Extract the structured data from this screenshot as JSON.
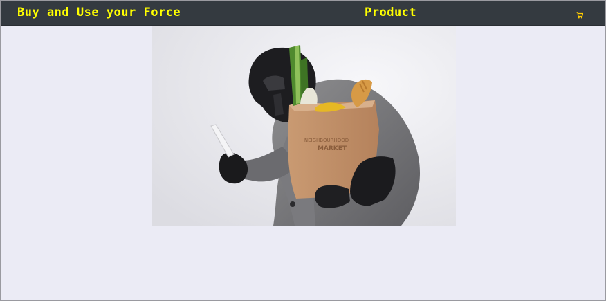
{
  "navbar": {
    "brand": "Buy and Use your Force",
    "title": "Product",
    "cart_icon": "shopping-cart-icon",
    "accent_color": "#ffff00",
    "background_color": "#343a40"
  },
  "main": {
    "product_image": {
      "icon": "product-photo",
      "bag_label_line1": "NEIGHBOURHOOD",
      "bag_label_line2": "MARKET"
    }
  }
}
